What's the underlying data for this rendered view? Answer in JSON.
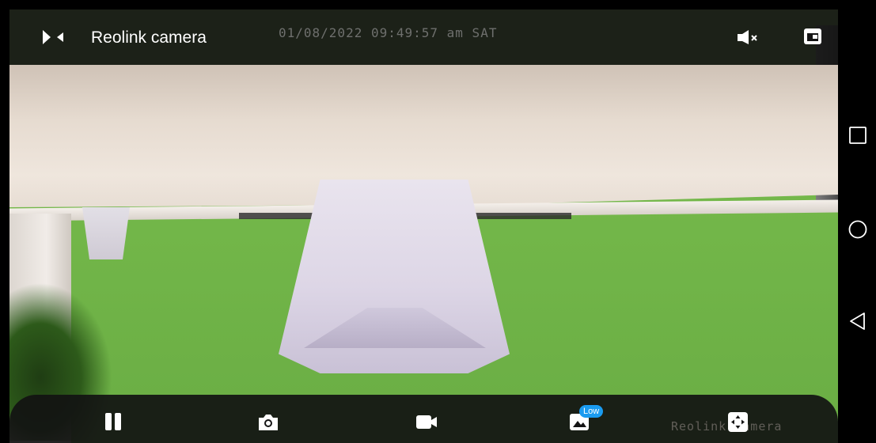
{
  "header": {
    "title": "Reolink camera",
    "timestamp": "01/08/2022 09:49:57 am SAT",
    "back_icon": "collapse-arrows-icon",
    "mute_icon": "speaker-muted-icon",
    "pip_icon": "picture-in-picture-icon"
  },
  "controls": {
    "pause_icon": "pause-icon",
    "snapshot_icon": "camera-icon",
    "record_icon": "video-camera-icon",
    "quality_icon": "image-quality-icon",
    "quality_badge": "Low",
    "ptz_icon": "ptz-directional-pad-icon"
  },
  "overlay": {
    "watermark": "Reolink camera"
  },
  "navigation": {
    "recent_icon": "square-recent-apps-icon",
    "home_icon": "circle-home-icon",
    "back_icon": "triangle-back-icon"
  },
  "colors": {
    "badge": "#1a9bf0",
    "bar_background": "#141414",
    "icon": "#ffffff"
  }
}
